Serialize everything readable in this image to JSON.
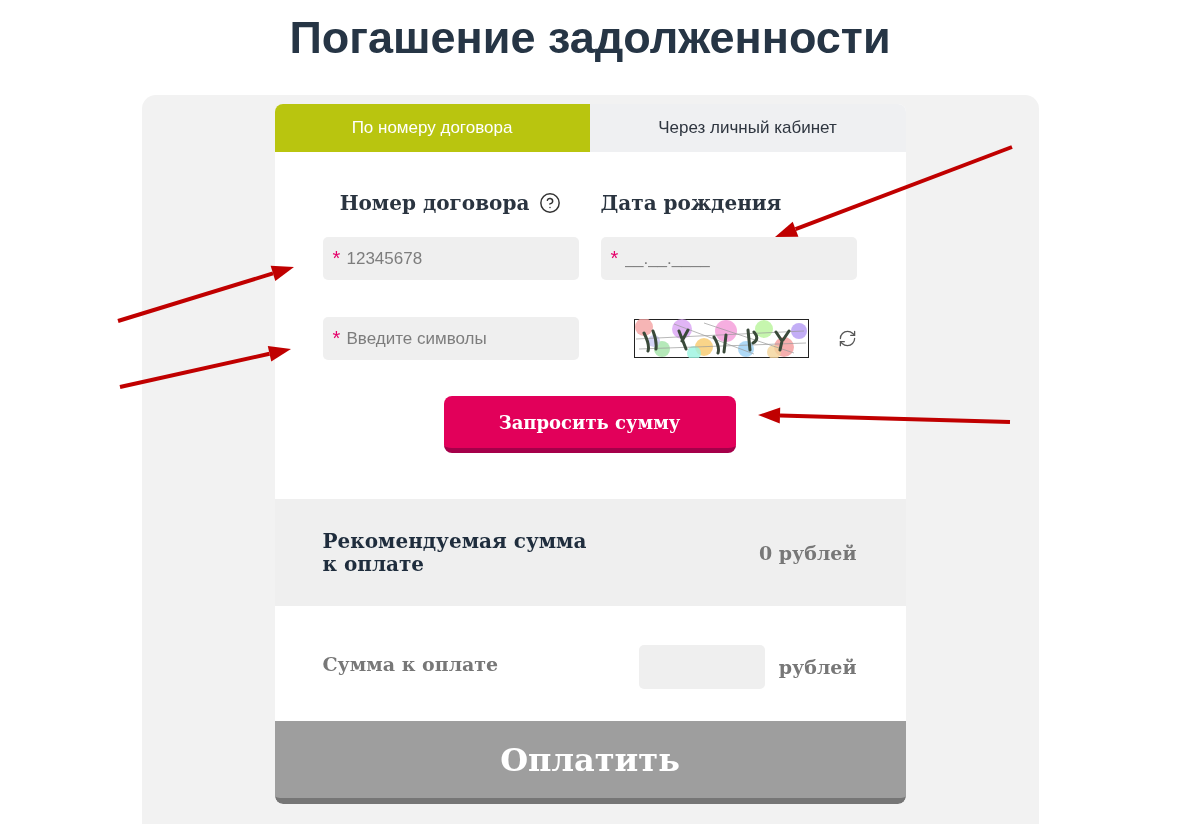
{
  "page": {
    "title": "Погашение задолженности"
  },
  "tabs": [
    {
      "label": "По номеру договора",
      "selected": true
    },
    {
      "label": "Через личный кабинет",
      "selected": false
    }
  ],
  "form": {
    "fields": [
      {
        "label": "Номер договора",
        "help": true,
        "required_mark": "*",
        "placeholder": "12345678"
      },
      {
        "label": "Дата рождения",
        "help": false,
        "required_mark": "*",
        "placeholder": "__.__.____"
      }
    ],
    "captcha": {
      "required_mark": "*",
      "placeholder": "Введите символы"
    },
    "submit": "Запросить сумму"
  },
  "recommended": {
    "label": "Рекомендуемая сумма к оплате",
    "value": "0 рублей"
  },
  "payment": {
    "label": "Сумма к оплате",
    "unit": "рублей",
    "button": "Оплатить",
    "disabled": true
  }
}
